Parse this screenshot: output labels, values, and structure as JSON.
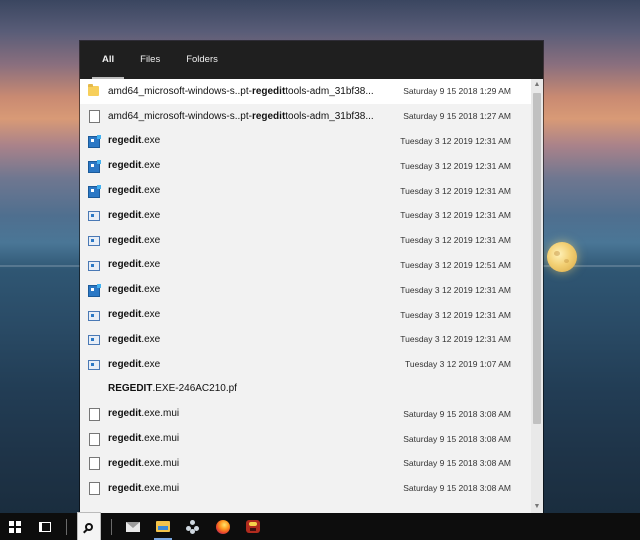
{
  "desktop": {
    "background": "sunset sea with moon"
  },
  "search_panel": {
    "tabs": [
      {
        "label": "All",
        "active": true
      },
      {
        "label": "Files",
        "active": false
      },
      {
        "label": "Folders",
        "active": false
      }
    ],
    "results": [
      {
        "icon": "folder-icon",
        "pre": "amd64_microsoft-windows-s..pt-",
        "match": "regedit",
        "post": "tools-adm_31bf38...",
        "date": "Saturday 9 15 2018 1:29 AM"
      },
      {
        "icon": "file-icon",
        "pre": "amd64_microsoft-windows-s..pt-",
        "match": "regedit",
        "post": "tools-adm_31bf38...",
        "date": "Saturday 9 15 2018 1:27 AM"
      },
      {
        "icon": "regedit-app-icon",
        "pre": "",
        "match": "regedit",
        "post": ".exe",
        "date": "Tuesday 3 12 2019 12:31 AM"
      },
      {
        "icon": "regedit-app-icon",
        "pre": "",
        "match": "regedit",
        "post": ".exe",
        "date": "Tuesday 3 12 2019 12:31 AM"
      },
      {
        "icon": "regedit-app-icon",
        "pre": "",
        "match": "regedit",
        "post": ".exe",
        "date": "Tuesday 3 12 2019 12:31 AM"
      },
      {
        "icon": "regedit-window-icon",
        "pre": "",
        "match": "regedit",
        "post": ".exe",
        "date": "Tuesday 3 12 2019 12:31 AM"
      },
      {
        "icon": "regedit-window-icon",
        "pre": "",
        "match": "regedit",
        "post": ".exe",
        "date": "Tuesday 3 12 2019 12:31 AM"
      },
      {
        "icon": "regedit-window-icon",
        "pre": "",
        "match": "regedit",
        "post": ".exe",
        "date": "Tuesday 3 12 2019 12:51 AM"
      },
      {
        "icon": "regedit-app-icon",
        "pre": "",
        "match": "regedit",
        "post": ".exe",
        "date": "Tuesday 3 12 2019 12:31 AM"
      },
      {
        "icon": "regedit-window-icon",
        "pre": "",
        "match": "regedit",
        "post": ".exe",
        "date": "Tuesday 3 12 2019 12:31 AM"
      },
      {
        "icon": "regedit-window-icon",
        "pre": "",
        "match": "regedit",
        "post": ".exe",
        "date": "Tuesday 3 12 2019 12:31 AM"
      },
      {
        "icon": "regedit-window-icon",
        "pre": "",
        "match": "regedit",
        "post": ".exe",
        "date": "Tuesday 3 12 2019 1:07 AM"
      },
      {
        "icon": "none",
        "pre": "",
        "match": "REGEDIT",
        "post": ".EXE-246AC210.pf",
        "date": ""
      },
      {
        "icon": "file-icon",
        "pre": "",
        "match": "regedit",
        "post": ".exe.mui",
        "date": "Saturday 9 15 2018 3:08 AM"
      },
      {
        "icon": "file-icon",
        "pre": "",
        "match": "regedit",
        "post": ".exe.mui",
        "date": "Saturday 9 15 2018 3:08 AM"
      },
      {
        "icon": "file-icon",
        "pre": "",
        "match": "regedit",
        "post": ".exe.mui",
        "date": "Saturday 9 15 2018 3:08 AM"
      },
      {
        "icon": "file-icon",
        "pre": "",
        "match": "regedit",
        "post": ".exe.mui",
        "date": "Saturday 9 15 2018 3:08 AM"
      }
    ]
  },
  "taskbar": {
    "items": [
      {
        "name": "start-button",
        "icon": "windows-logo-icon"
      },
      {
        "name": "task-view-button",
        "icon": "task-view-icon"
      },
      {
        "name": "search-button",
        "icon": "search-icon"
      },
      {
        "name": "mail-button",
        "icon": "mail-icon"
      },
      {
        "name": "file-explorer-button",
        "icon": "folder-icon"
      },
      {
        "name": "network-app-button",
        "icon": "network-icon"
      },
      {
        "name": "firefox-button",
        "icon": "firefox-icon"
      },
      {
        "name": "game-app-button",
        "icon": "game-icon"
      }
    ]
  }
}
